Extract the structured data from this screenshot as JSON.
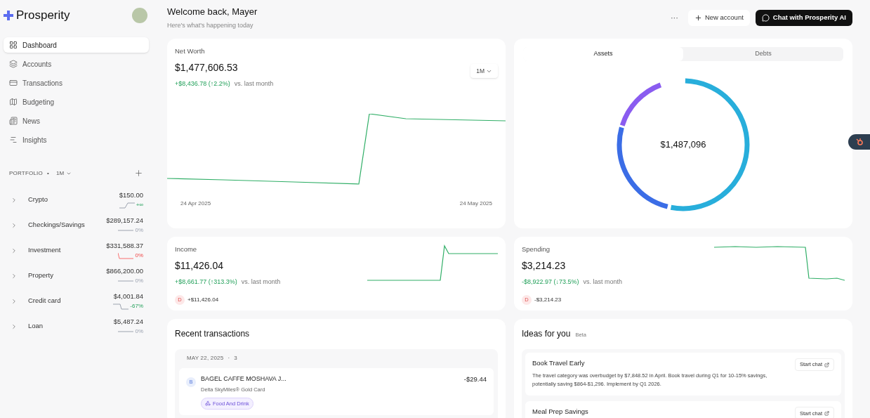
{
  "brand": "Prosperity",
  "nav": [
    {
      "label": "Dashboard",
      "kind": "grid",
      "selected": true
    },
    {
      "label": "Accounts",
      "kind": "layers",
      "selected": false
    },
    {
      "label": "Transactions",
      "kind": "card",
      "selected": false
    },
    {
      "label": "Budgeting",
      "kind": "map",
      "selected": false
    },
    {
      "label": "News",
      "kind": "news",
      "selected": false
    },
    {
      "label": "Insights",
      "kind": "chart",
      "selected": false
    }
  ],
  "portfolio": {
    "title": "PORTFOLIO",
    "separator": "•",
    "period": "1M",
    "items": [
      {
        "name": "Crypto",
        "value": "$150.00",
        "change": "+∞",
        "kind": "up"
      },
      {
        "name": "Checkings/Savings",
        "value": "$289,157.24",
        "change": "0%",
        "kind": "flat"
      },
      {
        "name": "Investment",
        "value": "$331,588.37",
        "change": "0%",
        "kind": "down"
      },
      {
        "name": "Property",
        "value": "$866,200.00",
        "change": "0%",
        "kind": "flat"
      },
      {
        "name": "Credit card",
        "value": "$4,001.84",
        "change": "-67%",
        "kind": "drop"
      },
      {
        "name": "Loan",
        "value": "$5,487.24",
        "change": "0%",
        "kind": "flat"
      }
    ]
  },
  "header": {
    "title": "Welcome back, Mayer",
    "subtitle": "Here's what's happening today",
    "more": "···",
    "new_account": "New account",
    "chat": "Chat with Prosperity AI"
  },
  "net_worth": {
    "label": "Net Worth",
    "value": "$1,477,606.53",
    "change": "+$8,436.78 (↑2.2%)",
    "comparison": "vs. last month",
    "period": "1M",
    "start_date": "24 Apr 2025",
    "end_date": "24 May 2025"
  },
  "allocation": {
    "tabs": [
      {
        "label": "Assets",
        "selected": true
      },
      {
        "label": "Debts",
        "selected": false
      }
    ],
    "total": "$1,487,096"
  },
  "income": {
    "label": "Income",
    "value": "$11,426.04",
    "change": "+$8,661.77 (↑313.3%)",
    "comparison": "vs. last month",
    "badge": "D",
    "badge_amount": "+$11,426.04"
  },
  "spending": {
    "label": "Spending",
    "value": "$3,214.23",
    "change": "-$8,922.97 (↓73.5%)",
    "comparison": "vs. last month",
    "badge": "D",
    "badge_amount": "-$3,214.23"
  },
  "recent": {
    "title": "Recent transactions",
    "date": "MAY 22, 2025",
    "separator": "·",
    "count": "3",
    "transactions": [
      {
        "initial": "B",
        "merchant": "BAGEL CAFFE MOSHAVA J...",
        "account": "Delta SkyMiles® Gold Card",
        "amount": "-$29.44",
        "category": "Food And Drink"
      }
    ]
  },
  "ideas": {
    "title": "Ideas for you",
    "badge": "Beta",
    "items": [
      {
        "title": "Book Travel Early",
        "text": "The travel category was overbudget by $7,848.52 in April. Book travel during Q1 for 10-15% savings, potentially saving $864-$1,296. Implement by Q1 2026.",
        "action": "Start chat"
      },
      {
        "title": "Meal Prep Savings",
        "action": "Start chat"
      }
    ]
  }
}
